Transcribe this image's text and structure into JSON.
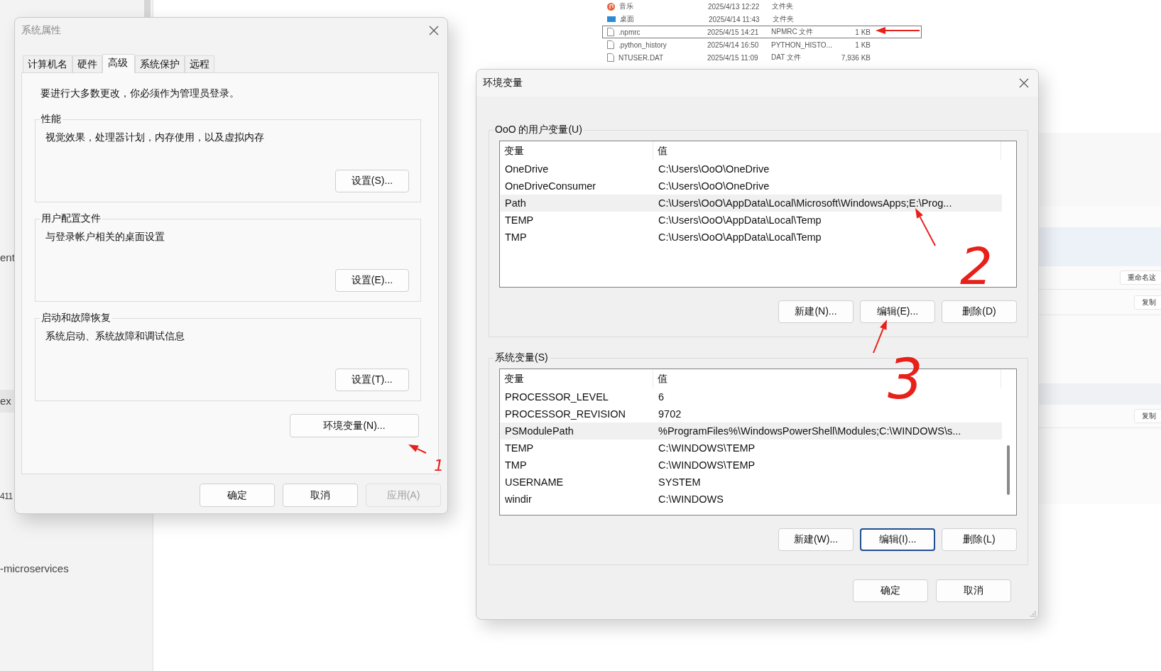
{
  "background": {
    "sidebar_items": [
      {
        "text": "ent",
        "selected": false
      },
      {
        "text": "ex",
        "selected": true
      },
      {
        "text": "411",
        "selected": false
      },
      {
        "text": "-microservices",
        "selected": false
      }
    ],
    "file_list": {
      "rows": [
        {
          "kind": "music",
          "name": "音乐",
          "date": "2025/4/13 12:22",
          "type": "文件夹",
          "selected": false
        },
        {
          "kind": "desktop",
          "name": "桌面",
          "date": "2025/4/14 11:43",
          "type": "文件夹",
          "selected": false
        },
        {
          "kind": "file",
          "name": ".npmrc",
          "date": "2025/4/15 14:21",
          "type": "NPMRC 文件",
          "size": "1 KB",
          "selected": true
        },
        {
          "kind": "file",
          "name": ".python_history",
          "date": "2025/4/14 16:50",
          "type": "PYTHON_HISTO...",
          "size": "1 KB",
          "selected": false
        },
        {
          "kind": "file",
          "name": "NTUSER.DAT",
          "date": "2025/4/15 11:09",
          "type": "DAT 文件",
          "size": "7,936 KB",
          "selected": false
        }
      ]
    },
    "side_panel": {
      "buttons": [
        "重命名这",
        "复制",
        "复制"
      ]
    }
  },
  "system_properties": {
    "title": "系统属性",
    "tabs": [
      {
        "label": "计算机名",
        "selected": false
      },
      {
        "label": "硬件",
        "selected": false
      },
      {
        "label": "高级",
        "selected": true
      },
      {
        "label": "系统保护",
        "selected": false
      },
      {
        "label": "远程",
        "selected": false
      }
    ],
    "notice": "要进行大多数更改，你必须作为管理员登录。",
    "groups": [
      {
        "title": "性能",
        "description": "视觉效果，处理器计划，内存使用，以及虚拟内存",
        "button": "设置(S)..."
      },
      {
        "title": "用户配置文件",
        "description": "与登录帐户相关的桌面设置",
        "button": "设置(E)..."
      },
      {
        "title": "启动和故障恢复",
        "description": "系统启动、系统故障和调试信息",
        "button": "设置(T)..."
      }
    ],
    "env_button": "环境变量(N)...",
    "buttons": [
      {
        "label": "确定",
        "disabled": false
      },
      {
        "label": "取消",
        "disabled": false
      },
      {
        "label": "应用(A)",
        "disabled": true
      }
    ]
  },
  "environment_variables": {
    "title": "环境变量",
    "user_vars": {
      "title": "OoO 的用户变量(U)",
      "columns": [
        "变量",
        "值"
      ],
      "rows": [
        {
          "name": "OneDrive",
          "value": "C:\\Users\\OoO\\OneDrive",
          "selected": false
        },
        {
          "name": "OneDriveConsumer",
          "value": "C:\\Users\\OoO\\OneDrive",
          "selected": false
        },
        {
          "name": "Path",
          "value": "C:\\Users\\OoO\\AppData\\Local\\Microsoft\\WindowsApps;E:\\Prog...",
          "selected": true
        },
        {
          "name": "TEMP",
          "value": "C:\\Users\\OoO\\AppData\\Local\\Temp",
          "selected": false
        },
        {
          "name": "TMP",
          "value": "C:\\Users\\OoO\\AppData\\Local\\Temp",
          "selected": false
        }
      ],
      "buttons": [
        {
          "label": "新建(N)...",
          "focused": false
        },
        {
          "label": "编辑(E)...",
          "focused": false
        },
        {
          "label": "删除(D)",
          "focused": false
        }
      ]
    },
    "system_vars": {
      "title": "系统变量(S)",
      "columns": [
        "变量",
        "值"
      ],
      "rows": [
        {
          "name": "PROCESSOR_LEVEL",
          "value": "6",
          "selected": false
        },
        {
          "name": "PROCESSOR_REVISION",
          "value": "9702",
          "selected": false
        },
        {
          "name": "PSModulePath",
          "value": "%ProgramFiles%\\WindowsPowerShell\\Modules;C:\\WINDOWS\\s...",
          "selected": true
        },
        {
          "name": "TEMP",
          "value": "C:\\WINDOWS\\TEMP",
          "selected": false
        },
        {
          "name": "TMP",
          "value": "C:\\WINDOWS\\TEMP",
          "selected": false
        },
        {
          "name": "USERNAME",
          "value": "SYSTEM",
          "selected": false
        },
        {
          "name": "windir",
          "value": "C:\\WINDOWS",
          "selected": false
        }
      ],
      "buttons": [
        {
          "label": "新建(W)...",
          "focused": false
        },
        {
          "label": "编辑(I)...",
          "focused": true
        },
        {
          "label": "删除(L)",
          "focused": false
        }
      ]
    },
    "buttons": [
      {
        "label": "确定",
        "focused": false
      },
      {
        "label": "取消",
        "focused": false
      }
    ]
  },
  "annotations": [
    {
      "text": "1"
    },
    {
      "text": "2"
    },
    {
      "text": "3"
    }
  ]
}
